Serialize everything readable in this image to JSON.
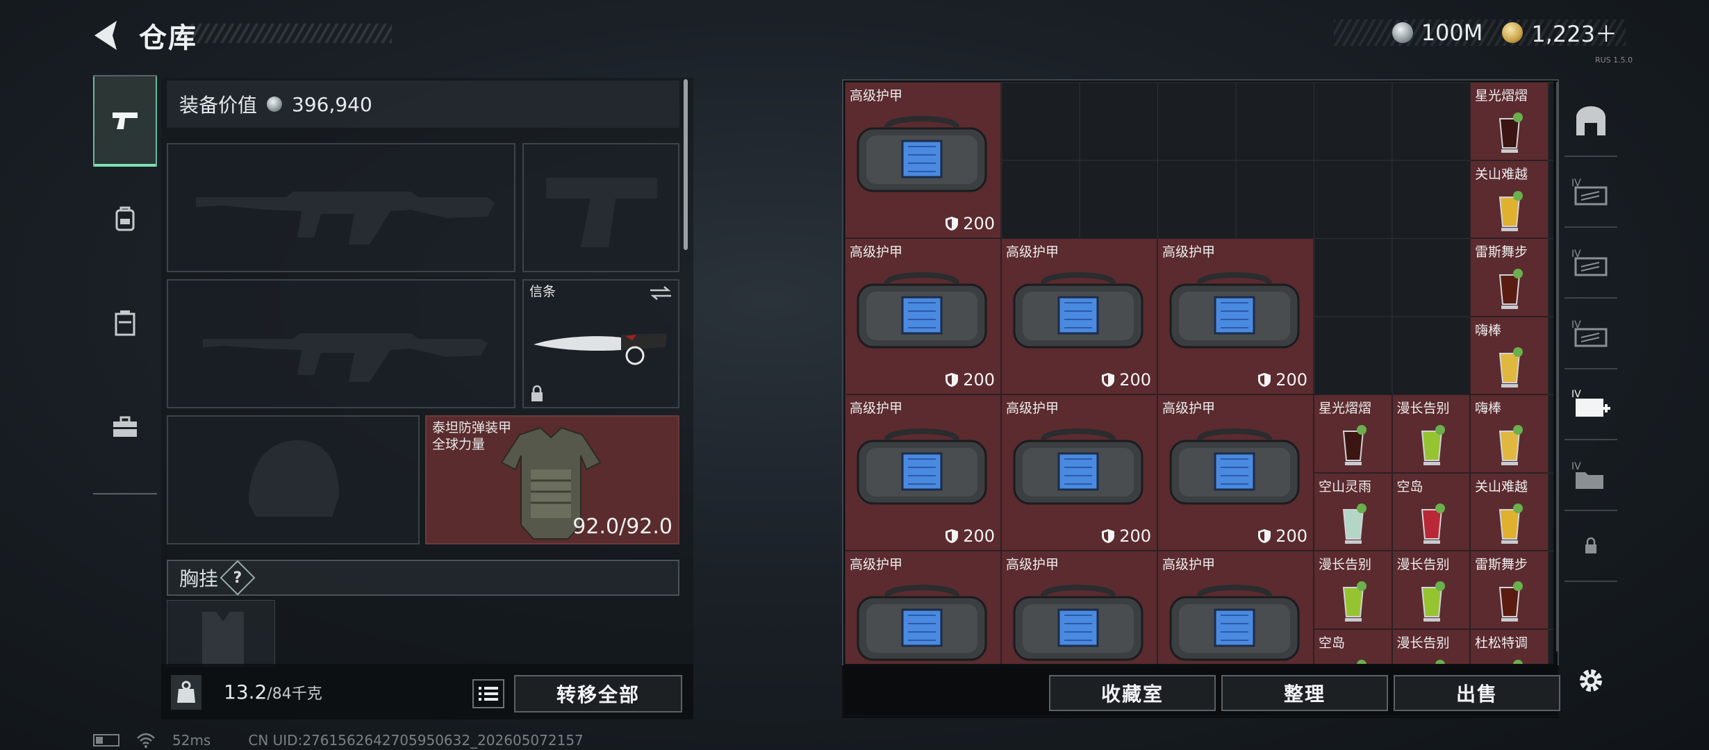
{
  "header": {
    "title": "仓库",
    "currencies": [
      {
        "icon": "silver-coin-icon",
        "value": "100M"
      },
      {
        "icon": "gold-coin-icon",
        "value": "1,223＋"
      }
    ],
    "tiny_text": "RUS 1.5.0"
  },
  "left_nav": {
    "items": [
      {
        "icon": "pistol-icon",
        "active": true
      },
      {
        "icon": "backpack-icon",
        "active": false
      },
      {
        "icon": "rig-icon",
        "active": false
      },
      {
        "icon": "toolbox-icon",
        "active": false
      }
    ]
  },
  "equipment": {
    "value_label": "装备价值",
    "value": "396,940",
    "knife_label": "信条",
    "armor_label_line1": "泰坦防弹装甲",
    "armor_label_line2": "全球力量",
    "armor_durability": "92.0/92.0",
    "chest_rig_label": "胸挂",
    "help": "?"
  },
  "footer_left": {
    "weight_current": "13.2",
    "weight_max": "/84千克",
    "transfer_all": "转移全部"
  },
  "grid": {
    "armor_label": "高级护甲",
    "armor_value": "200",
    "drinks": [
      {
        "label": "星光熠熠",
        "color": "#3a1410"
      },
      {
        "label": "关山难越",
        "color": "#e8b830"
      },
      {
        "label": "雷斯舞步",
        "color": "#5a1c10"
      },
      {
        "label": "嗨棒",
        "color": "#e8c040"
      },
      {
        "label": "星光熠熠",
        "color": "#3a1410"
      },
      {
        "label": "漫长告别",
        "color": "#9acd32"
      },
      {
        "label": "嗨棒",
        "color": "#e8c040"
      },
      {
        "label": "空山灵雨",
        "color": "#b8e0d0"
      },
      {
        "label": "空岛",
        "color": "#c02838"
      },
      {
        "label": "关山难越",
        "color": "#e8b830"
      },
      {
        "label": "漫长告别",
        "color": "#9acd32"
      },
      {
        "label": "漫长告别",
        "color": "#9acd32"
      },
      {
        "label": "雷斯舞步",
        "color": "#5a1c10"
      },
      {
        "label": "空岛",
        "color": "#c02838"
      },
      {
        "label": "漫长告别",
        "color": "#9acd32"
      },
      {
        "label": "杜松特调",
        "color": "#d8d0b0"
      }
    ]
  },
  "footer_right": {
    "collection": "收藏室",
    "sort": "整理",
    "sell": "出售"
  },
  "status": {
    "ping": "52ms",
    "uid": "CN UID:2761562642705950632_202605072157"
  },
  "colors": {
    "item_bg": "#5b2b2f",
    "accent": "#7be3b6"
  }
}
